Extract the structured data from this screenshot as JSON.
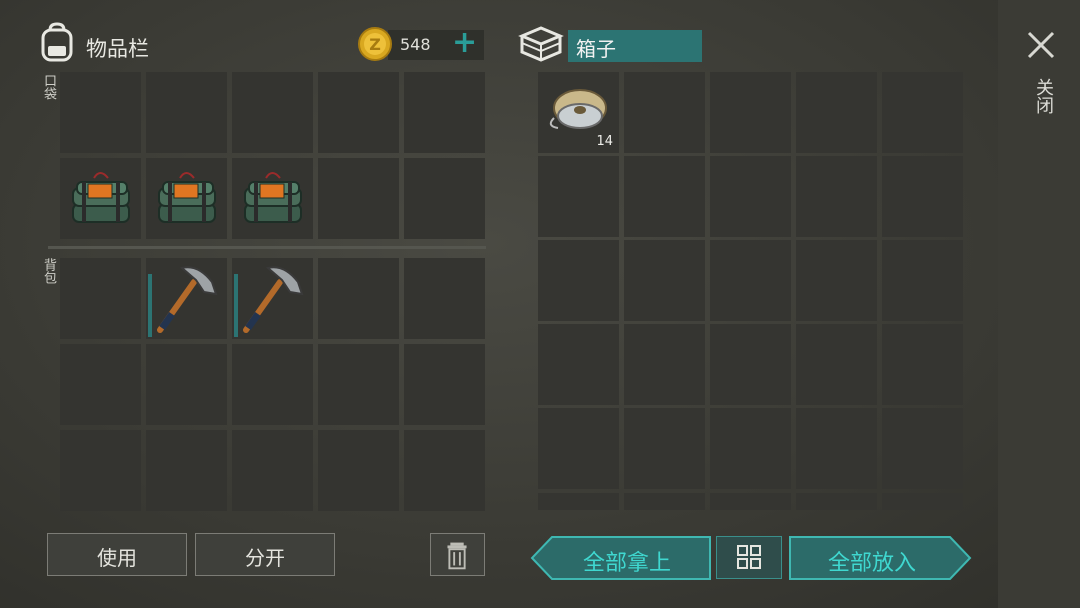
{
  "inventory": {
    "title": "物品栏",
    "currency": "548",
    "pocket_label": "口袋",
    "backpack_label": "背包",
    "items": [
      {
        "name": "c4-explosive",
        "row": 1,
        "col": 0
      },
      {
        "name": "c4-explosive",
        "row": 1,
        "col": 1
      },
      {
        "name": "c4-explosive",
        "row": 1,
        "col": 2
      },
      {
        "name": "pickaxe",
        "row": 2,
        "col": 1
      },
      {
        "name": "pickaxe",
        "row": 2,
        "col": 2
      }
    ]
  },
  "box": {
    "name": "箱子",
    "items": [
      {
        "name": "wire-spool",
        "count": "14",
        "row": 0,
        "col": 0
      }
    ]
  },
  "actions": {
    "use": "使用",
    "split": "分开",
    "take_all": "全部拿上",
    "put_all": "全部放入"
  },
  "close_label": "关闭",
  "colors": {
    "accent": "#2a9d98",
    "teal_text": "#3fd8d0",
    "teal_bg": "#2c6b69"
  }
}
